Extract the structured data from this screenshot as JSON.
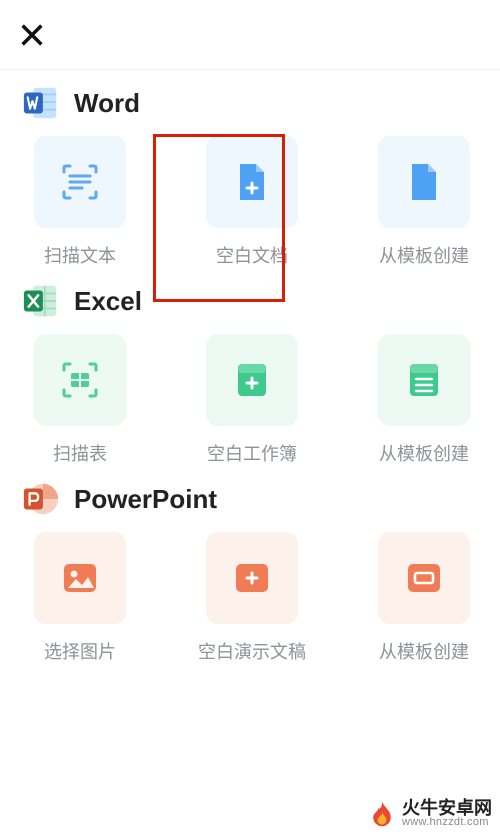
{
  "colors": {
    "word": "#4ea1f3",
    "excel": "#3ec98d",
    "ppt": "#ef7c55",
    "highlight": "#d81e06"
  },
  "sections": {
    "word": {
      "title": "Word",
      "tiles": [
        {
          "label": "扫描文本"
        },
        {
          "label": "空白文档"
        },
        {
          "label": "从模板创建"
        }
      ]
    },
    "excel": {
      "title": "Excel",
      "tiles": [
        {
          "label": "扫描表"
        },
        {
          "label": "空白工作簿"
        },
        {
          "label": "从模板创建"
        }
      ]
    },
    "ppt": {
      "title": "PowerPoint",
      "tiles": [
        {
          "label": "选择图片"
        },
        {
          "label": "空白演示文稿"
        },
        {
          "label": "从模板创建"
        }
      ]
    }
  },
  "watermark": {
    "name": "火牛安卓网",
    "url": "www.hnzzdt.com"
  }
}
